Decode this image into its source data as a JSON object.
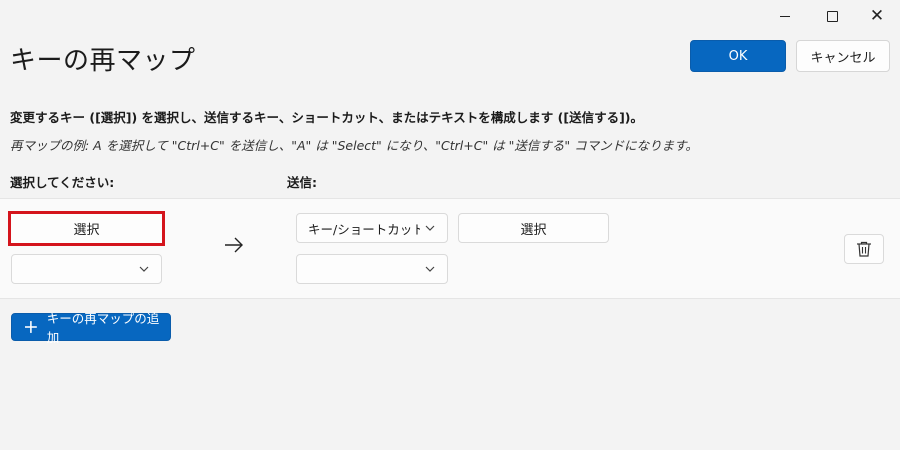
{
  "window": {
    "minimize_icon": "minimize-icon",
    "maximize_icon": "maximize-icon",
    "close_glyph": "✕"
  },
  "header": {
    "title": "キーの再マップ",
    "ok_label": "OK",
    "cancel_label": "キャンセル"
  },
  "description": "変更するキー ([選択]) を選択し、送信するキー、ショートカット、またはテキストを構成します ([送信する])。",
  "example": "再マップの例: A を選択して \"Ctrl+C\" を送信し、\"A\" は \"Select\" になり、\"Ctrl+C\" は \"送信する\" コマンドになります。",
  "columns": {
    "select_label": "選択してください:",
    "send_label": "送信:"
  },
  "mapping_row": {
    "source_select_label": "選択",
    "source_dropdown_value": "",
    "target_type_value": "キー/ショートカットの送",
    "target_select_label": "選択",
    "target_dropdown_value": "",
    "highlight_color": "#d4141c"
  },
  "add_button_label": "キーの再マップの追加",
  "colors": {
    "accent": "#0767c0",
    "background": "#f3f3f3",
    "panel": "#fafafa"
  }
}
